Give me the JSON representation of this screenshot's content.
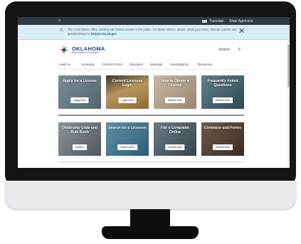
{
  "topbar": {
    "home_icon": "home-icon",
    "translate_label": "Translate",
    "agencies_label": "State Agencies"
  },
  "alert": {
    "icon": "warning-icon",
    "message": "The Commission office building has limited access to the public. For faster service, please email your name, license number and question/issue to",
    "email": "help@orec.ok.gov",
    "close_icon": "close-icon"
  },
  "header": {
    "logo_title": "OKLAHOMA",
    "logo_subtitle": "Real Estate Commission",
    "search_label": "Search",
    "search_icon": "search-icon"
  },
  "nav": {
    "items": [
      "I want to...",
      "Licensing",
      "Contract Forms",
      "Education",
      "Meetings",
      "Investigations",
      "Resources"
    ]
  },
  "tiles": [
    {
      "title": "Apply for a License",
      "button": "Apply Now"
    },
    {
      "title": "Current Licensee Login",
      "button": "Login Now"
    },
    {
      "title": "How to Obtain a License",
      "button": "Review Now"
    },
    {
      "title": "Frequently Asked Questions",
      "button": "Review Now"
    },
    {
      "title": "Oklahoma Code and Rule Book",
      "button": "Review"
    },
    {
      "title": "Search for a Licensee",
      "button": "Search Now"
    },
    {
      "title": "File a Complaint Online",
      "button": "Submit Now"
    },
    {
      "title": "Contracts and Forms",
      "button": "Review Now"
    }
  ],
  "colors": {
    "topbar": "#2f3a43",
    "alert_bg": "#d9eff8",
    "brand_blue": "#1f3f6e",
    "bezel": "#141414"
  }
}
